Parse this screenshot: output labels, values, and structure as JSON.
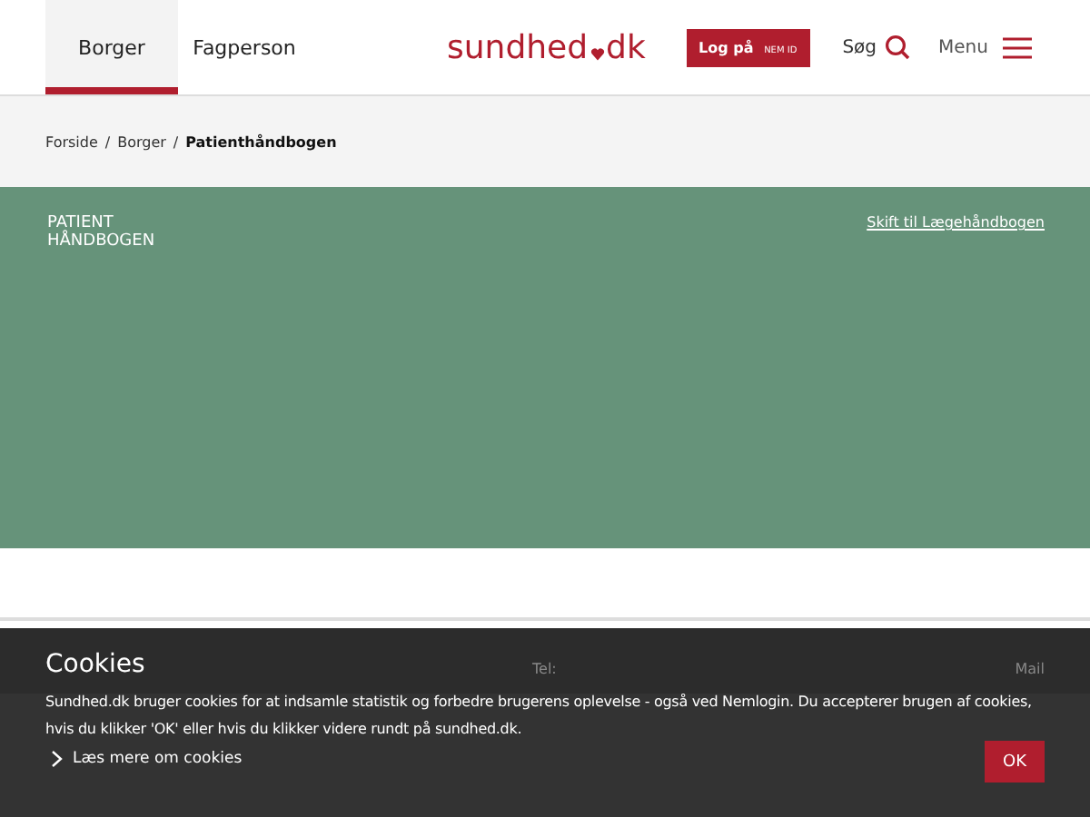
{
  "header": {
    "tabs": [
      {
        "label": "Borger",
        "selected": true
      },
      {
        "label": "Fagperson",
        "selected": false
      }
    ],
    "logo": {
      "part_1": "sundhed",
      "part_2": "dk"
    },
    "login": {
      "label": "Log på",
      "badge": "NEM ID"
    },
    "search": "Søg",
    "menu": "Menu"
  },
  "breadcrumb": [
    {
      "label": "Forside",
      "current": false,
      "separator": "/"
    },
    {
      "label": "Borger",
      "current": false,
      "separator": "/"
    },
    {
      "label": "Patienthåndbogen",
      "current": true
    }
  ],
  "hero": {
    "title_line_1": "PATIENT",
    "title_line_2": "HÅNDBOGEN",
    "link": "Skift til Lægehåndbogen"
  },
  "footer": {
    "column_1": "Tel:",
    "column_2": "Mail"
  },
  "cookie_banner": {
    "title": "Cookies",
    "text": "Sundhed.dk bruger cookies for at indsamle statistik og forbedre brugerens oplevelse - også ved Nemlogin. Du accepterer brugen af cookies, hvis du klikker 'OK' eller hvis du klikker videre rundt på sundhed.dk.",
    "link": "Læs mere om cookies",
    "button": "OK"
  }
}
